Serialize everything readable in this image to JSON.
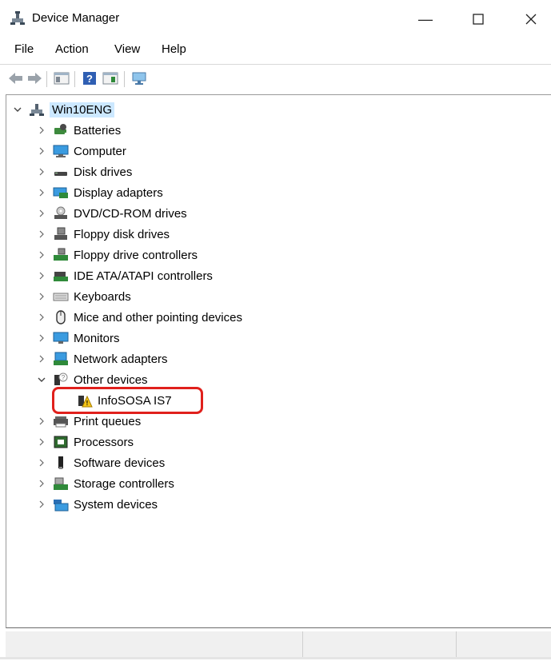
{
  "window": {
    "title": "Device Manager"
  },
  "menu": [
    "File",
    "Action",
    "View",
    "Help"
  ],
  "tree": {
    "root": "Win10ENG",
    "categories": [
      {
        "label": "Batteries",
        "icon": "battery-icon"
      },
      {
        "label": "Computer",
        "icon": "computer-icon"
      },
      {
        "label": "Disk drives",
        "icon": "disk-drive-icon"
      },
      {
        "label": "Display adapters",
        "icon": "display-adapter-icon"
      },
      {
        "label": "DVD/CD-ROM drives",
        "icon": "dvd-drive-icon"
      },
      {
        "label": "Floppy disk drives",
        "icon": "floppy-drive-icon"
      },
      {
        "label": "Floppy drive controllers",
        "icon": "floppy-controller-icon"
      },
      {
        "label": "IDE ATA/ATAPI controllers",
        "icon": "ide-controller-icon"
      },
      {
        "label": "Keyboards",
        "icon": "keyboard-icon"
      },
      {
        "label": "Mice and other pointing devices",
        "icon": "mouse-icon"
      },
      {
        "label": "Monitors",
        "icon": "monitor-icon"
      },
      {
        "label": "Network adapters",
        "icon": "network-adapter-icon"
      },
      {
        "label": "Other devices",
        "icon": "unknown-device-icon",
        "expanded": true,
        "children": [
          {
            "label": "InfoSOSA IS7",
            "icon": "warning-device-icon"
          }
        ]
      },
      {
        "label": "Print queues",
        "icon": "printer-icon"
      },
      {
        "label": "Processors",
        "icon": "processor-icon"
      },
      {
        "label": "Software devices",
        "icon": "software-device-icon"
      },
      {
        "label": "Storage controllers",
        "icon": "storage-controller-icon"
      },
      {
        "label": "System devices",
        "icon": "system-device-icon"
      }
    ]
  },
  "colors": {
    "selection": "#cce8ff",
    "highlight_box": "#e0201c"
  }
}
